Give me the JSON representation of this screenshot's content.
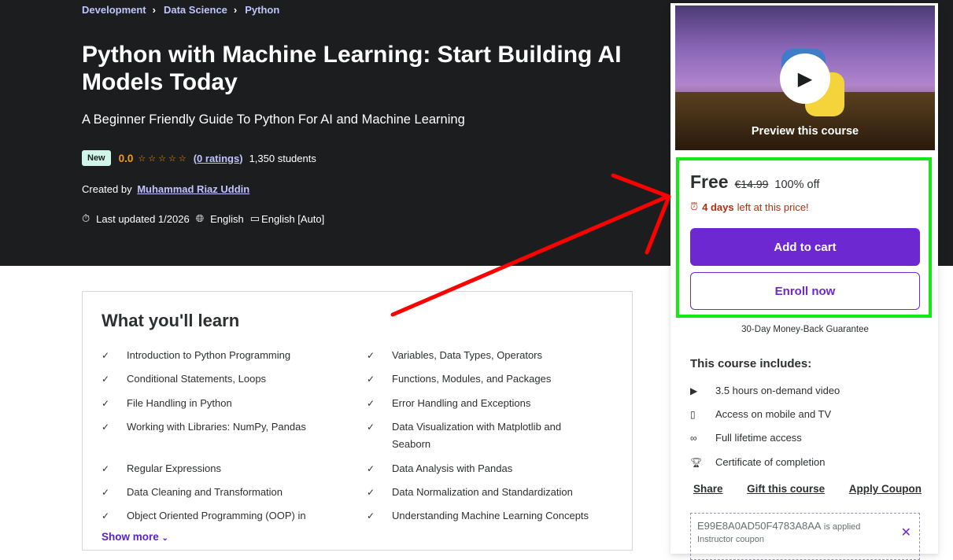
{
  "breadcrumb": [
    "Development",
    "Data Science",
    "Python"
  ],
  "course": {
    "title": "Python with Machine Learning: Start Building AI Models Today",
    "subtitle": "A Beginner Friendly Guide To Python For AI and Machine Learning",
    "badge": "New",
    "rating": "0.0",
    "stars": "☆☆☆☆☆",
    "ratings_link": "(0 ratings)",
    "students": "1,350 students",
    "created_by_label": "Created by",
    "author": "Muhammad Riaz Uddin",
    "last_updated": "Last updated 1/2026",
    "language": "English",
    "captions": "English [Auto]"
  },
  "learn": {
    "title": "What you'll learn",
    "items": [
      "Introduction to Python Programming",
      "Variables, Data Types, Operators",
      "Conditional Statements, Loops",
      "Functions, Modules, and Packages",
      "File Handling in Python",
      "Error Handling and Exceptions",
      "Working with Libraries: NumPy, Pandas",
      "Data Visualization with Matplotlib and Seaborn",
      "Regular Expressions",
      "Data Analysis with Pandas",
      "Data Cleaning and Transformation",
      "Data Normalization and Standardization",
      "Object Oriented Programming (OOP) in",
      "Understanding Machine Learning Concepts"
    ],
    "show_more": "Show more"
  },
  "sidebar": {
    "preview_label": "Preview this course",
    "price": "Free",
    "old_price": "€14.99",
    "discount": "100% off",
    "timer_days": "4 days",
    "timer_rest": "left at this price!",
    "add_to_cart": "Add to cart",
    "enroll": "Enroll now",
    "guarantee": "30-Day Money-Back Guarantee",
    "includes_title": "This course includes:",
    "includes": [
      "3.5 hours on-demand video",
      "Access on mobile and TV",
      "Full lifetime access",
      "Certificate of completion"
    ],
    "share": "Share",
    "gift": "Gift this course",
    "coupon_link": "Apply Coupon",
    "coupon_code": "E99E8A0AD50F4783A8AA",
    "coupon_applied": "is applied",
    "coupon_note": "Instructor coupon"
  },
  "colors": {
    "hero_bg": "#1c1d1f",
    "accent": "#6d28d2",
    "link": "#c0c4fc",
    "star": "#f69c08",
    "highlight_box": "#15e815",
    "annotation_arrow": "#ff0000"
  }
}
